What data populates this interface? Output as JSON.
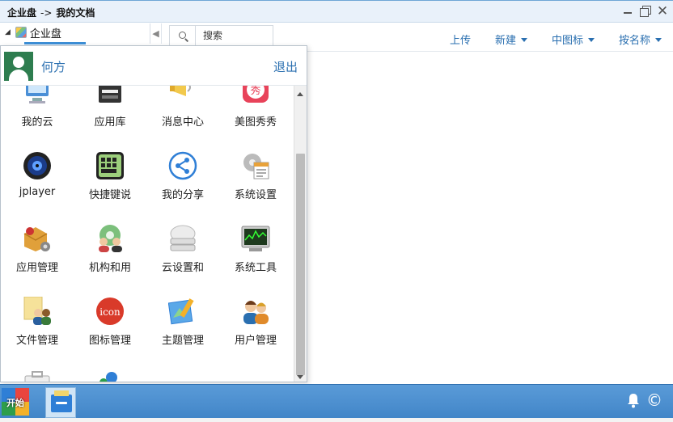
{
  "window": {
    "breadcrumb_root": "企业盘",
    "breadcrumb_sep": "->",
    "breadcrumb_current": "我的文档",
    "close_glyph": "✕"
  },
  "tree": {
    "root_label": "企业盘",
    "expand_glyph": "◢",
    "collapse_glyph": "◀"
  },
  "search": {
    "placeholder": "搜索"
  },
  "toolbar": {
    "upload": "上传",
    "new": "新建",
    "view": "中图标",
    "sort": "按名称"
  },
  "start_menu": {
    "user_name": "何方",
    "logout": "退出",
    "apps": [
      {
        "label": "我的云",
        "icon": "monitor-cloud-icon"
      },
      {
        "label": "应用库",
        "icon": "app-store-icon"
      },
      {
        "label": "消息中心",
        "icon": "megaphone-icon"
      },
      {
        "label": "美图秀秀",
        "icon": "meitu-icon"
      },
      {
        "label": "jplayer",
        "icon": "speaker-icon"
      },
      {
        "label": "快捷键说",
        "icon": "keyboard-icon"
      },
      {
        "label": "我的分享",
        "icon": "share-icon"
      },
      {
        "label": "系统设置",
        "icon": "gear-document-icon"
      },
      {
        "label": "应用管理",
        "icon": "box-gear-icon"
      },
      {
        "label": "机构和用",
        "icon": "users-gear-icon"
      },
      {
        "label": "云设置和",
        "icon": "cloud-server-icon"
      },
      {
        "label": "系统工具",
        "icon": "monitor-chart-icon"
      },
      {
        "label": "文件管理",
        "icon": "file-users-icon"
      },
      {
        "label": "图标管理",
        "icon": "icon-badge-icon"
      },
      {
        "label": "主题管理",
        "icon": "theme-brush-icon"
      },
      {
        "label": "用户管理",
        "icon": "users-icon"
      }
    ]
  },
  "taskbar": {
    "start_label": "开始",
    "tray_copyright": "©"
  },
  "colors": {
    "accent": "#2a6fb0",
    "taskbar": "#4a8fd0",
    "avatar": "#2e7d4f"
  }
}
